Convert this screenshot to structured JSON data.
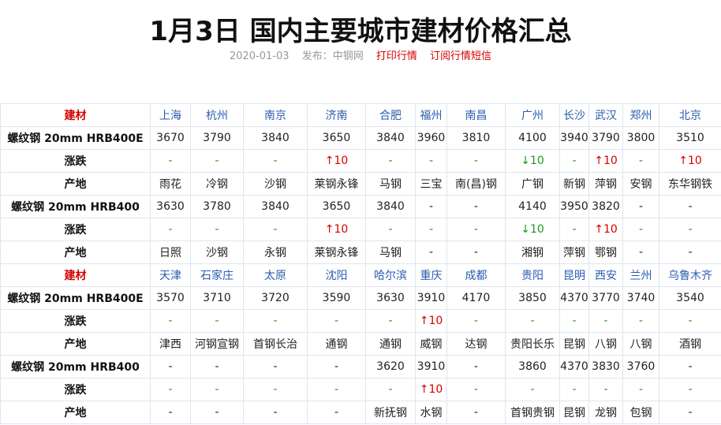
{
  "header": {
    "title": "1月3日 国内主要城市建材价格汇总",
    "date": "2020-01-03",
    "source": "发布：中钢网",
    "print_link": "打印行情",
    "subscribe_link": "订阅行情短信"
  },
  "colors": {
    "red": "#d40000",
    "green": "#1a9a1a",
    "city_blue": "#2a5db0"
  },
  "table": {
    "rows": [
      {
        "type": "header",
        "cells": [
          "建材",
          "上海",
          "杭州",
          "南京",
          "济南",
          "合肥",
          "福州",
          "南昌",
          "广州",
          "长沙",
          "武汉",
          "郑州",
          "北京"
        ]
      },
      {
        "type": "price",
        "cells": [
          "螺纹钢 20mm HRB400E",
          "3670",
          "3790",
          "3840",
          "3650",
          "3840",
          "3960",
          "3810",
          "4100",
          "3940",
          "3790",
          "3800",
          "3510"
        ]
      },
      {
        "type": "change",
        "cells": [
          "涨跌",
          "-",
          "-",
          "-",
          "↑10",
          "-",
          "-",
          "-",
          "↓10",
          "-",
          "↑10",
          "-",
          "↑10"
        ]
      },
      {
        "type": "origin",
        "cells": [
          "产地",
          "雨花",
          "冷钢",
          "沙钢",
          "莱钢永锋",
          "马钢",
          "三宝",
          "南(昌)钢",
          "广钢",
          "新钢",
          "萍钢",
          "安钢",
          "东华钢铁"
        ]
      },
      {
        "type": "price",
        "cells": [
          "螺纹钢 20mm HRB400",
          "3630",
          "3780",
          "3840",
          "3650",
          "3840",
          "-",
          "-",
          "4140",
          "3950",
          "3820",
          "-",
          "-"
        ]
      },
      {
        "type": "change",
        "cells": [
          "涨跌",
          "-",
          "-",
          "-",
          "↑10",
          "-",
          "-",
          "-",
          "↓10",
          "-",
          "↑10",
          "-",
          "-"
        ]
      },
      {
        "type": "origin",
        "cells": [
          "产地",
          "日照",
          "沙钢",
          "永钢",
          "莱钢永锋",
          "马钢",
          "-",
          "-",
          "湘钢",
          "萍钢",
          "鄂钢",
          "-",
          "-"
        ]
      },
      {
        "type": "header",
        "cells": [
          "建材",
          "天津",
          "石家庄",
          "太原",
          "沈阳",
          "哈尔滨",
          "重庆",
          "成都",
          "贵阳",
          "昆明",
          "西安",
          "兰州",
          "乌鲁木齐"
        ]
      },
      {
        "type": "price",
        "cells": [
          "螺纹钢 20mm HRB400E",
          "3570",
          "3710",
          "3720",
          "3590",
          "3630",
          "3910",
          "4170",
          "3850",
          "4370",
          "3770",
          "3740",
          "3540"
        ]
      },
      {
        "type": "change",
        "cells": [
          "涨跌",
          "-",
          "-",
          "-",
          "-",
          "-",
          "↑10",
          "-",
          "-",
          "-",
          "-",
          "-",
          "-"
        ]
      },
      {
        "type": "origin",
        "cells": [
          "产地",
          "津西",
          "河钢宣钢",
          "首钢长治",
          "通钢",
          "通钢",
          "威钢",
          "达钢",
          "贵阳长乐",
          "昆钢",
          "八钢",
          "八钢",
          "酒钢"
        ]
      },
      {
        "type": "price",
        "cells": [
          "螺纹钢 20mm HRB400",
          "-",
          "-",
          "-",
          "-",
          "3620",
          "3910",
          "-",
          "3860",
          "4370",
          "3830",
          "3760",
          "-"
        ]
      },
      {
        "type": "change",
        "cells": [
          "涨跌",
          "-",
          "-",
          "-",
          "-",
          "-",
          "↑10",
          "-",
          "-",
          "-",
          "-",
          "-",
          "-"
        ]
      },
      {
        "type": "origin",
        "cells": [
          "产地",
          "-",
          "-",
          "-",
          "-",
          "新抚钢",
          "水钢",
          "-",
          "首钢贵钢",
          "昆钢",
          "龙钢",
          "包钢",
          "-"
        ]
      }
    ]
  }
}
